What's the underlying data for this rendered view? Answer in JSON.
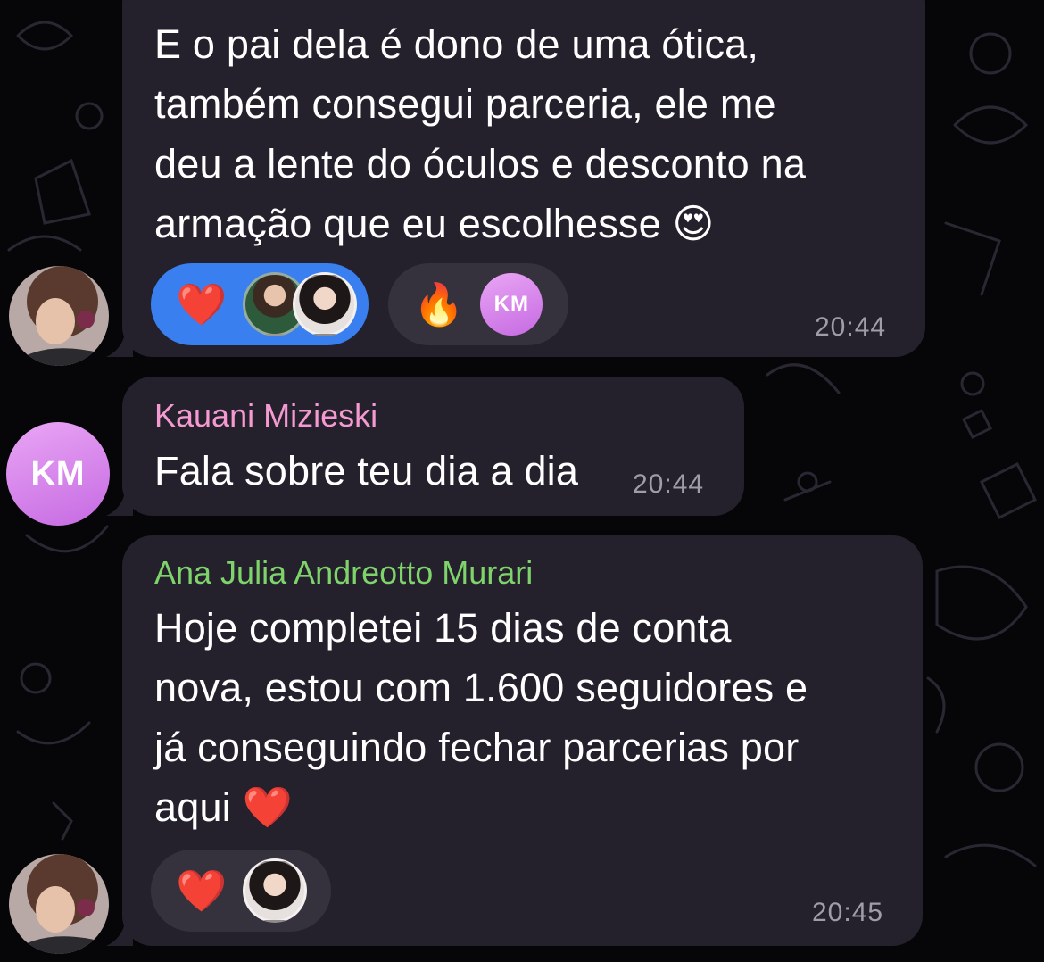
{
  "colors": {
    "background": "#060608",
    "bubble": "#24212d",
    "reaction_active": "#3a7ff0",
    "reaction_inactive": "#35323d",
    "sender_pink": "#f49ad1",
    "sender_green": "#7fd36b",
    "time": "#a09ca8"
  },
  "messages": [
    {
      "text": "E o pai dela é dono de uma ótica,\ntambém consegui parceria, ele me\ndeu a lente do óculos e desconto na\narmação que eu escolhesse 😍",
      "time": "20:44",
      "reactions": [
        {
          "emoji": "❤️",
          "reactors": [
            "reactor-photo",
            "reactor-photo"
          ],
          "active": true
        },
        {
          "emoji": "🔥",
          "reactors": [
            "KM"
          ],
          "active": false
        }
      ]
    },
    {
      "sender": "Kauani Mizieski",
      "avatar_initials": "KM",
      "text": "Fala sobre teu dia a dia",
      "time": "20:44"
    },
    {
      "sender": "Ana Julia Andreotto Murari",
      "text": "Hoje completei 15 dias de conta\nnova, estou com 1.600 seguidores e\njá conseguindo fechar parcerias por\naqui ❤️",
      "time": "20:45",
      "reactions": [
        {
          "emoji": "❤️",
          "reactors": [
            "reactor-photo"
          ],
          "active": false
        }
      ]
    }
  ]
}
